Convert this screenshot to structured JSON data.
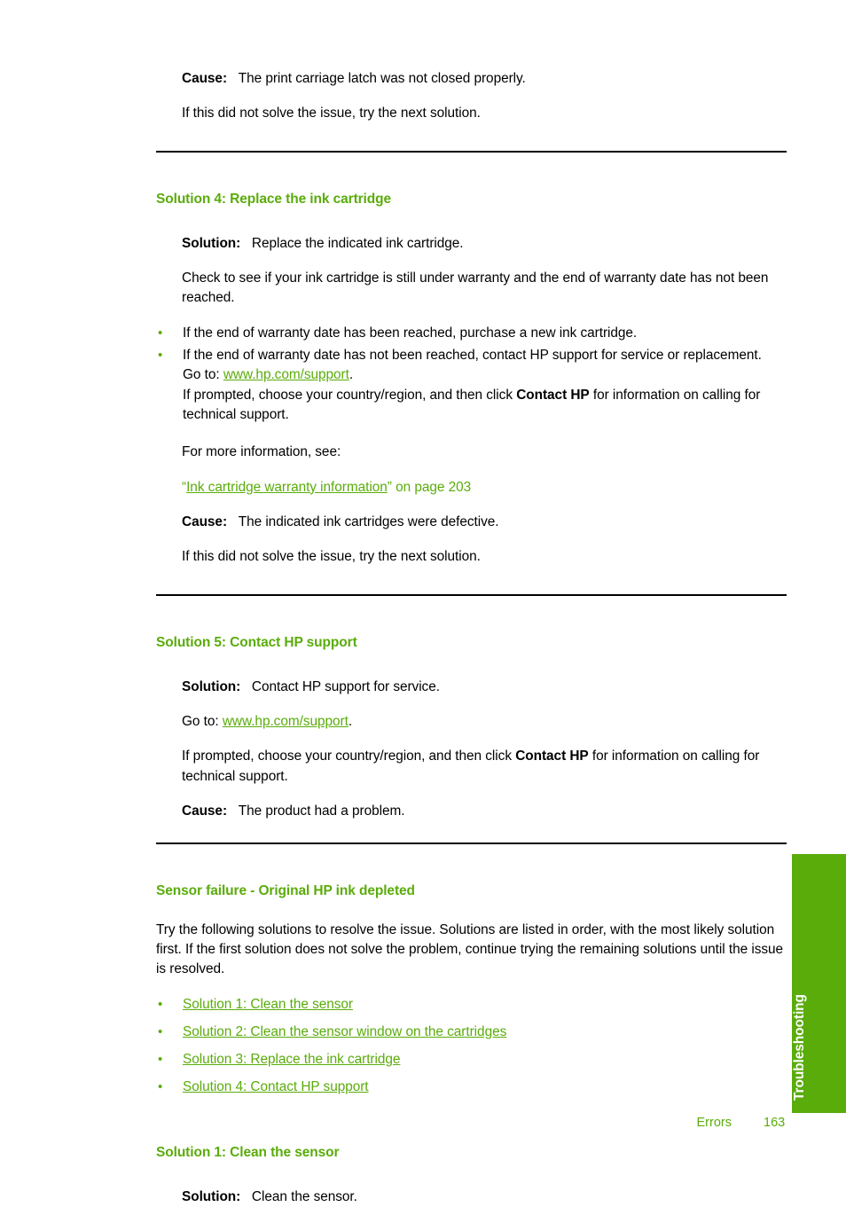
{
  "document": {
    "footer": {
      "section": "Errors",
      "page_number": "163"
    },
    "side_tab": {
      "label": "Troubleshooting"
    },
    "accent_color": "#5aac0b",
    "text_color": "#000000"
  },
  "top_block": {
    "cause_label": "Cause:",
    "cause_text": "The print carriage latch was not closed properly.",
    "next_solution": "If this did not solve the issue, try the next solution."
  },
  "solution4": {
    "heading": "Solution 4: Replace the ink cartridge",
    "solution_label": "Solution:",
    "solution_text": "Replace the indicated ink cartridge.",
    "warranty_check": "Check to see if your ink cartridge is still under warranty and the end of warranty date has not been reached.",
    "bullets": [
      {
        "text": "If the end of warranty date has been reached, purchase a new ink cartridge."
      },
      {
        "text": "If the end of warranty date has not been reached, contact HP support for service or replacement.",
        "goto_prefix": "Go to: ",
        "goto_link": "www.hp.com/support",
        "goto_suffix": ".",
        "prompt_prefix": "If prompted, choose your country/region, and then click ",
        "prompt_bold": "Contact HP",
        "prompt_suffix": " for information on calling for technical support."
      }
    ],
    "more_info": "For more information, see:",
    "xref_quote_open": "“",
    "xref_link": "Ink cartridge warranty information",
    "xref_quote_close": "”",
    "xref_page": " on page 203",
    "cause_label": "Cause:",
    "cause_text": "The indicated ink cartridges were defective.",
    "next_solution": "If this did not solve the issue, try the next solution."
  },
  "solution5": {
    "heading": "Solution 5: Contact HP support",
    "solution_label": "Solution:",
    "solution_text": "Contact HP support for service.",
    "goto_prefix": "Go to: ",
    "goto_link": "www.hp.com/support",
    "goto_suffix": ".",
    "prompt_prefix": "If prompted, choose your country/region, and then click ",
    "prompt_bold": "Contact HP",
    "prompt_suffix": " for information on calling for technical support.",
    "cause_label": "Cause:",
    "cause_text": "The product had a problem."
  },
  "sensor_section": {
    "heading": "Sensor failure - Original HP ink depleted",
    "intro": "Try the following solutions to resolve the issue. Solutions are listed in order, with the most likely solution first. If the first solution does not solve the problem, continue trying the remaining solutions until the issue is resolved.",
    "links": [
      "Solution 1: Clean the sensor",
      "Solution 2: Clean the sensor window on the cartridges",
      "Solution 3: Replace the ink cartridge",
      "Solution 4: Contact HP support"
    ]
  },
  "solution1": {
    "heading": "Solution 1: Clean the sensor",
    "solution_label": "Solution:",
    "solution_text": "Clean the sensor."
  }
}
